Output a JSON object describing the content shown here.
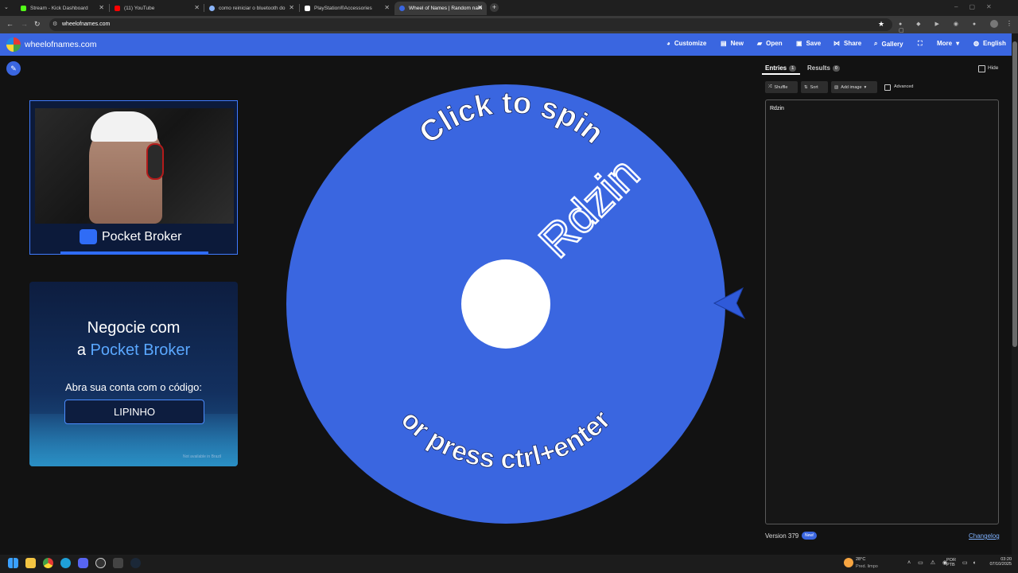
{
  "browser": {
    "tabs": [
      {
        "label": "Stream - Kick Dashboard",
        "color": "#53fc18"
      },
      {
        "label": "(11) YouTube",
        "color": "#ff0000"
      },
      {
        "label": "como reiniciar o bluetooth do",
        "color": "#8ab4f8"
      },
      {
        "label": "PlayStation®Accessories",
        "color": "#ffffff"
      },
      {
        "label": "Wheel of Names | Random nam",
        "color": "#3a66e0"
      }
    ],
    "url": "wheelofnames.com"
  },
  "app": {
    "site_name": "wheelofnames.com",
    "menu": {
      "customize": "Customize",
      "new": "New",
      "open": "Open",
      "save": "Save",
      "share": "Share",
      "gallery": "Gallery",
      "more": "More",
      "language": "English"
    },
    "accent": "#3a66e0"
  },
  "ads": {
    "ad1_brand": "Pocket Broker",
    "ad2_line1": "Negocie com",
    "ad2_prefix": "a ",
    "ad2_brand": "Pocket Broker",
    "ad2_line3": "Abra sua conta com o código:",
    "ad2_code": "LIPINHO",
    "ad2_footnote": "Not available in Brazil"
  },
  "wheel": {
    "entry_label": "Rdzin",
    "spin_text": "Click to spin",
    "press_text": "or press ctrl+enter",
    "color": "#3a66e0"
  },
  "panel": {
    "tab_entries": "Entries",
    "entries_count": "1",
    "tab_results": "Results",
    "results_count": "0",
    "hide": "Hide",
    "shuffle": "Shuffle",
    "sort": "Sort",
    "add_image": "Add image",
    "advanced": "Advanced",
    "entries_text": "Rdzin",
    "version": "Version 379",
    "new_badge": "New!",
    "changelog": "Changelog"
  },
  "taskbar": {
    "weather_temp": "28°C",
    "weather_desc": "Pred. limpo",
    "lang1": "POR",
    "lang2": "PTB",
    "time": "03:20",
    "date": "07/10/2025"
  }
}
